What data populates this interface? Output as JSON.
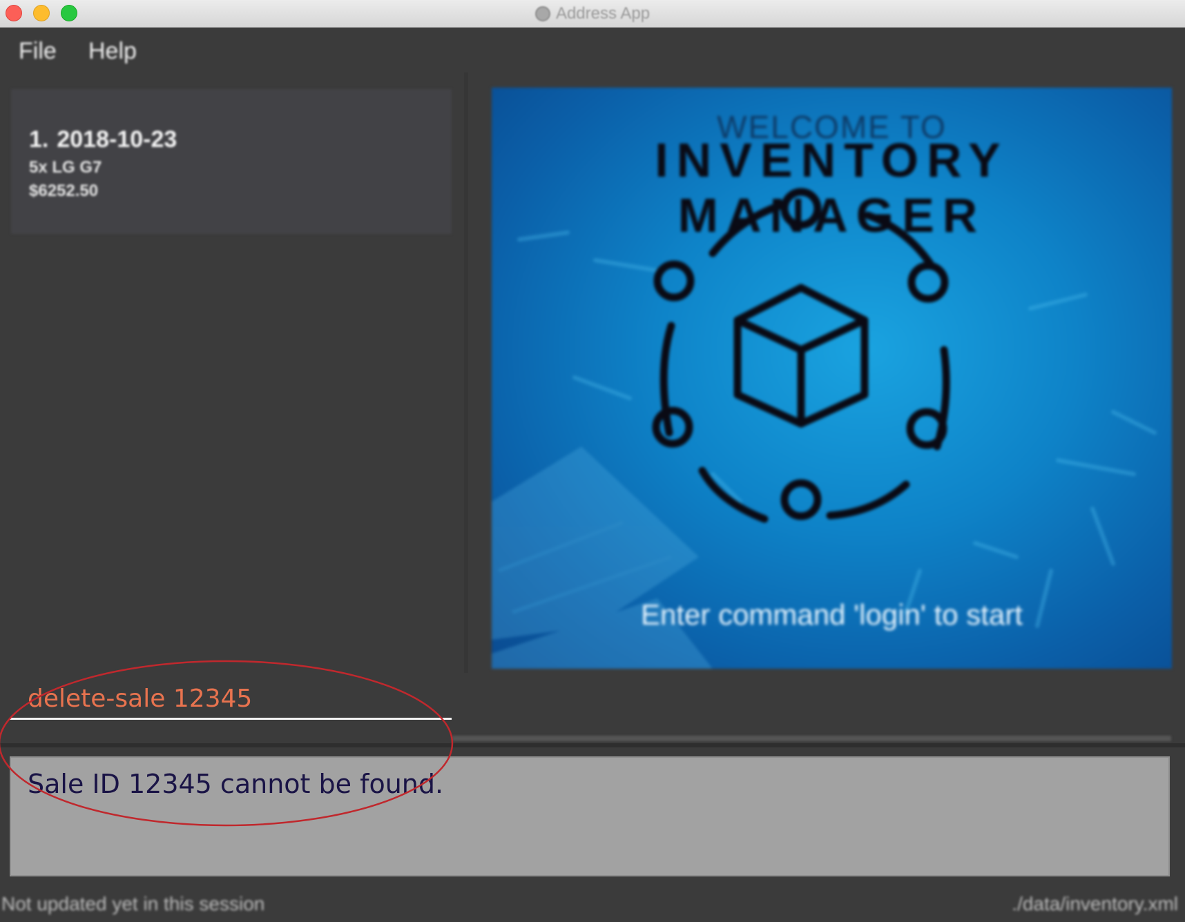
{
  "window": {
    "title": "Address App"
  },
  "menu": {
    "file": "File",
    "help": "Help"
  },
  "sales_list": [
    {
      "index": "1.",
      "date": "2018-10-23",
      "item": "5x LG G7",
      "total": "$6252.50"
    }
  ],
  "splash": {
    "welcome": "WELCOME TO",
    "heading": "INVENTORY MANAGER",
    "subtitle": "Enter command 'login' to start"
  },
  "command": {
    "value": "delete-sale 12345"
  },
  "result": {
    "message": "Sale ID 12345 cannot be found."
  },
  "status": {
    "left": "Not updated yet in this session",
    "right": "./data/inventory.xml"
  },
  "annotation": {
    "color": "#c0282d"
  },
  "icons": {
    "app": "app-icon",
    "logo": "inventory-box-network-icon"
  }
}
